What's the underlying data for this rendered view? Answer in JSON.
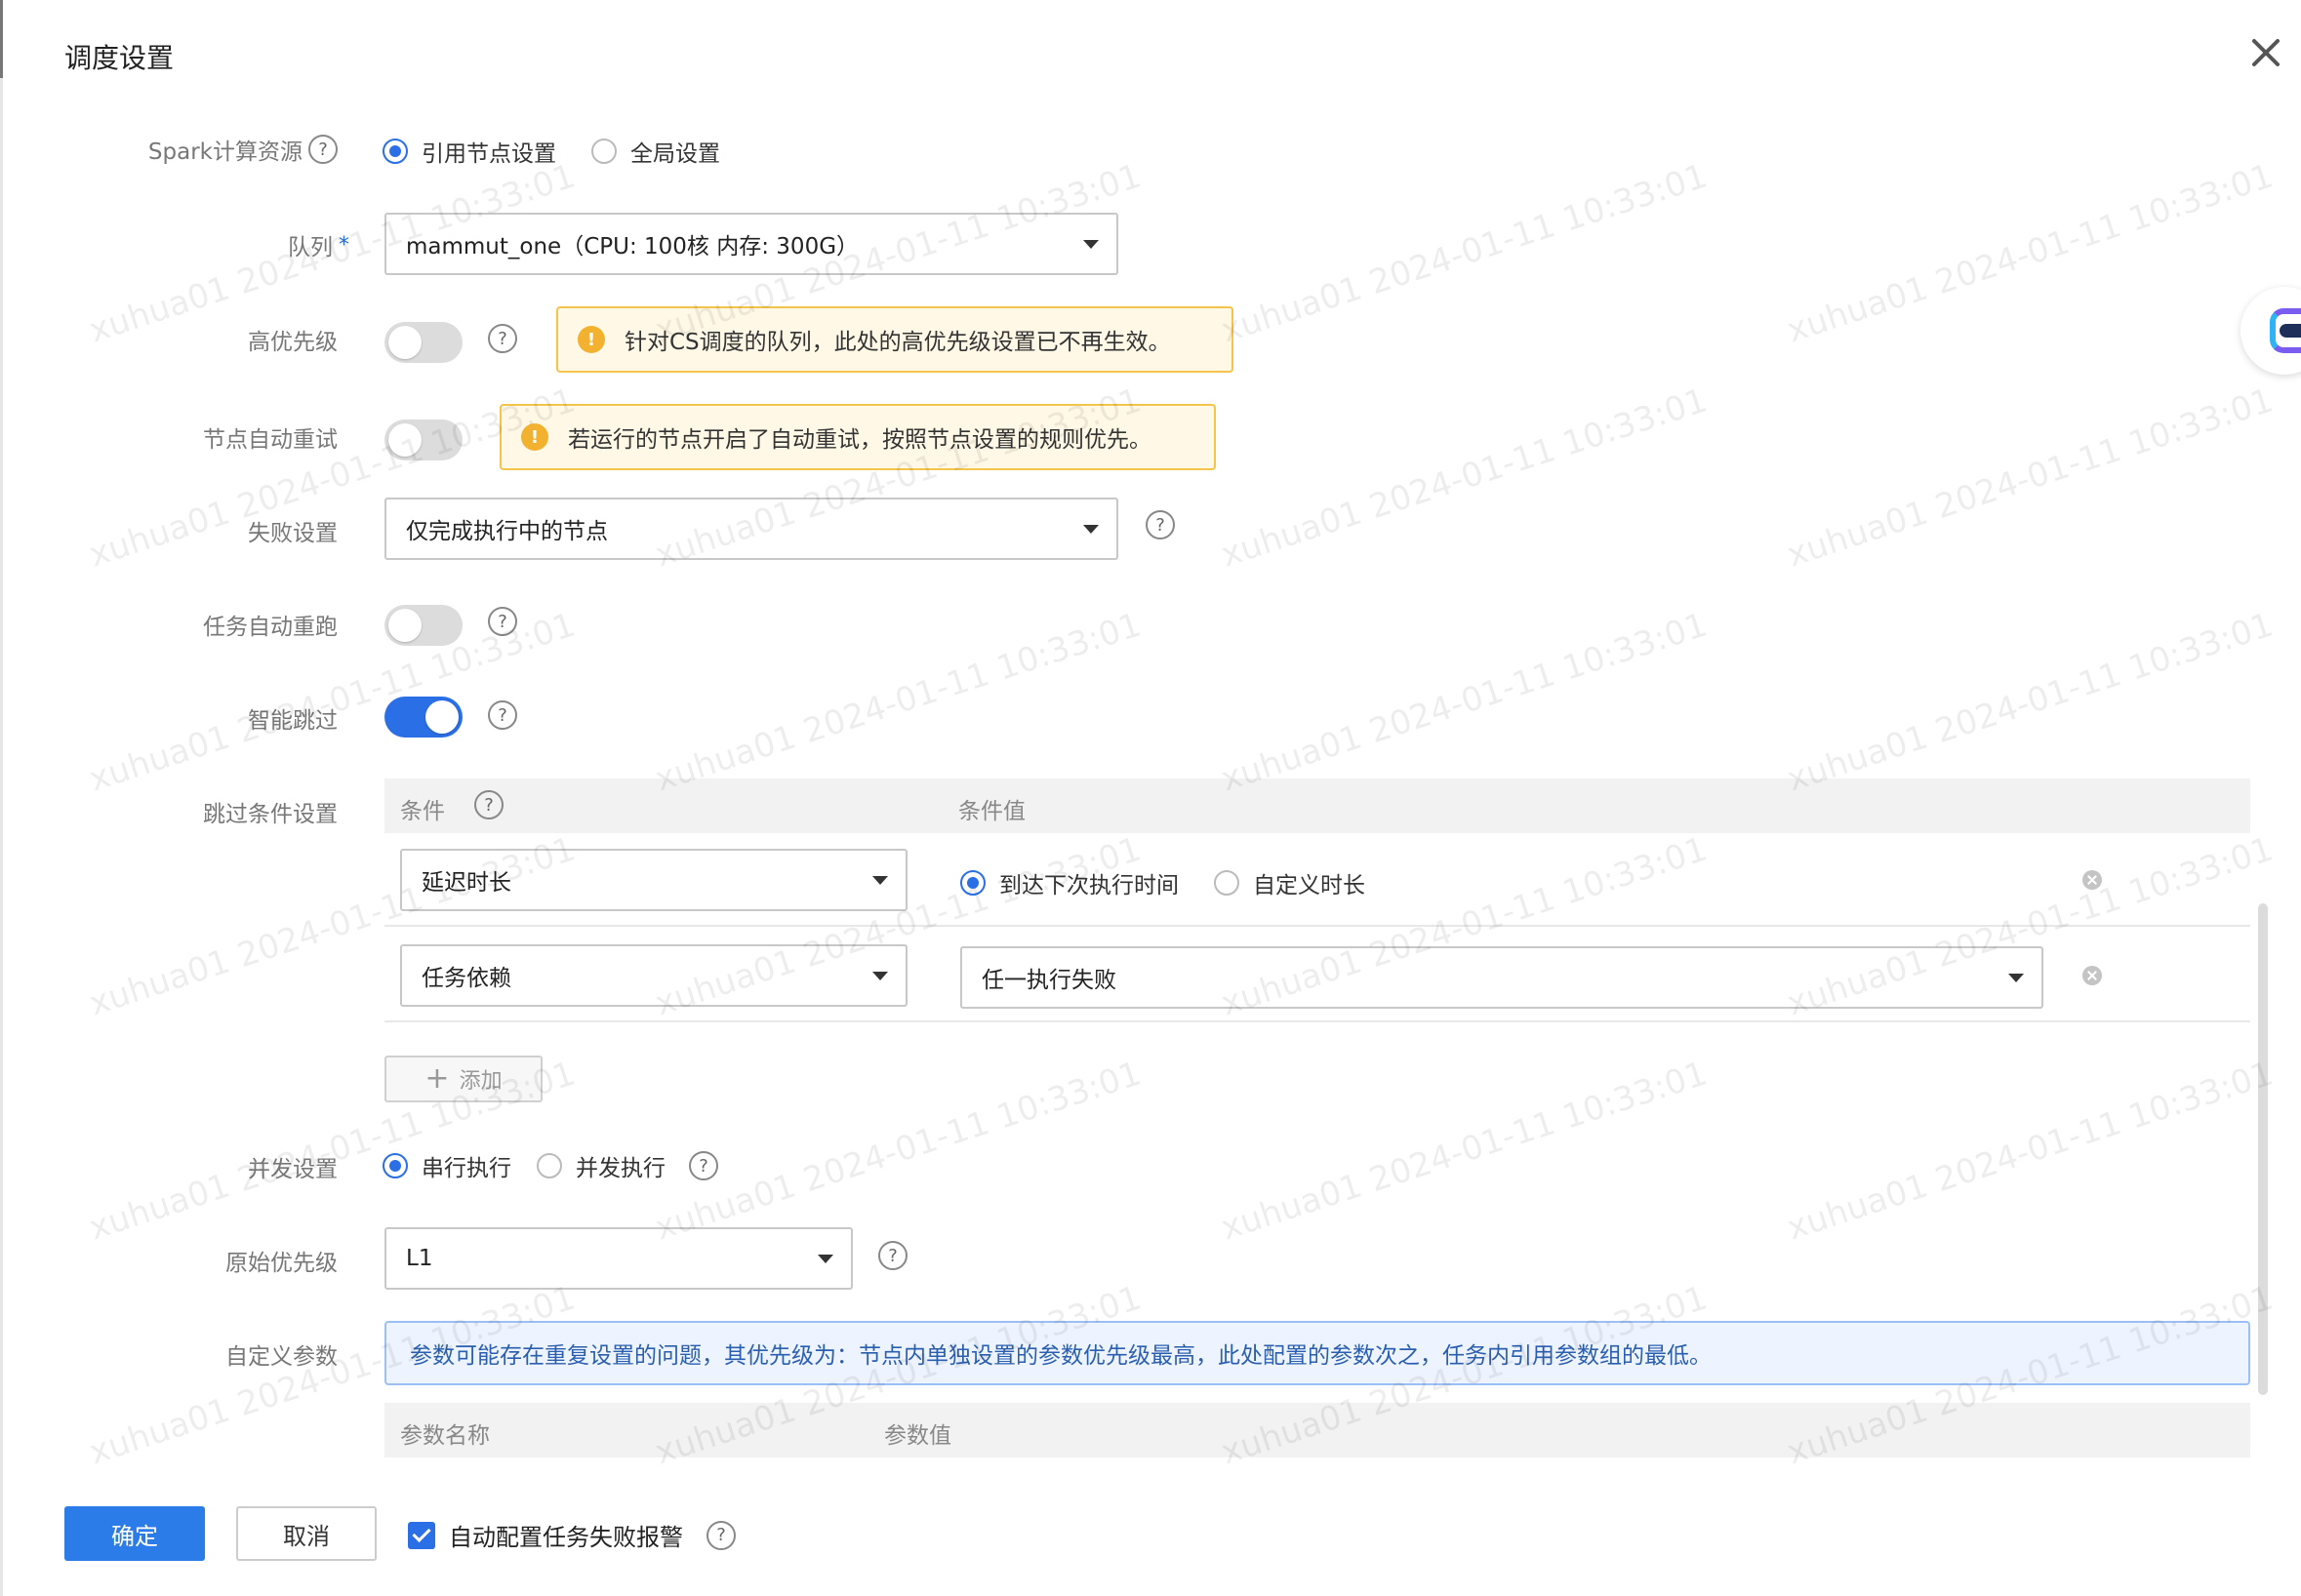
{
  "dialog": {
    "title": "调度设置"
  },
  "spark": {
    "label": "Spark计算资源",
    "options": [
      "引用节点设置",
      "全局设置"
    ],
    "selected": "引用节点设置"
  },
  "queue": {
    "label": "队列",
    "required_mark": "*",
    "value": "mammut_one（CPU: 100核 内存: 300G）"
  },
  "high_priority": {
    "label": "高优先级",
    "enabled": false,
    "warning": "针对CS调度的队列，此处的高优先级设置已不再生效。"
  },
  "node_retry": {
    "label": "节点自动重试",
    "enabled": false,
    "warning": "若运行的节点开启了自动重试，按照节点设置的规则优先。"
  },
  "failure": {
    "label": "失败设置",
    "value": "仅完成执行中的节点"
  },
  "task_rerun": {
    "label": "任务自动重跑",
    "enabled": false
  },
  "smart_skip": {
    "label": "智能跳过",
    "enabled": true
  },
  "skip_conditions": {
    "label": "跳过条件设置",
    "columns": [
      "条件",
      "条件值"
    ],
    "rows": [
      {
        "condition": "延迟时长",
        "value_options": [
          "到达下次执行时间",
          "自定义时长"
        ],
        "value_selected": "到达下次执行时间"
      },
      {
        "condition": "任务依赖",
        "value": "任一执行失败"
      }
    ],
    "add_label": "添加"
  },
  "concurrency": {
    "label": "并发设置",
    "options": [
      "串行执行",
      "并发执行"
    ],
    "selected": "串行执行"
  },
  "priority": {
    "label": "原始优先级",
    "value": "L1"
  },
  "custom_params": {
    "label": "自定义参数",
    "info": "参数可能存在重复设置的问题，其优先级为：节点内单独设置的参数优先级最高，此处配置的参数次之，任务内引用参数组的最低。",
    "columns": [
      "参数名称",
      "参数值"
    ]
  },
  "footer": {
    "confirm": "确定",
    "cancel": "取消",
    "auto_alert_label": "自动配置任务失败报警",
    "auto_alert_checked": true
  },
  "watermark_text": "xuhua01 2024-01-11 10:33:01",
  "colors": {
    "primary": "#2b7be8",
    "warning_bg": "#fff8e6",
    "warning_border": "#f5c44a",
    "info_bg": "#eef4ff",
    "info_border": "#9cc0f5"
  }
}
